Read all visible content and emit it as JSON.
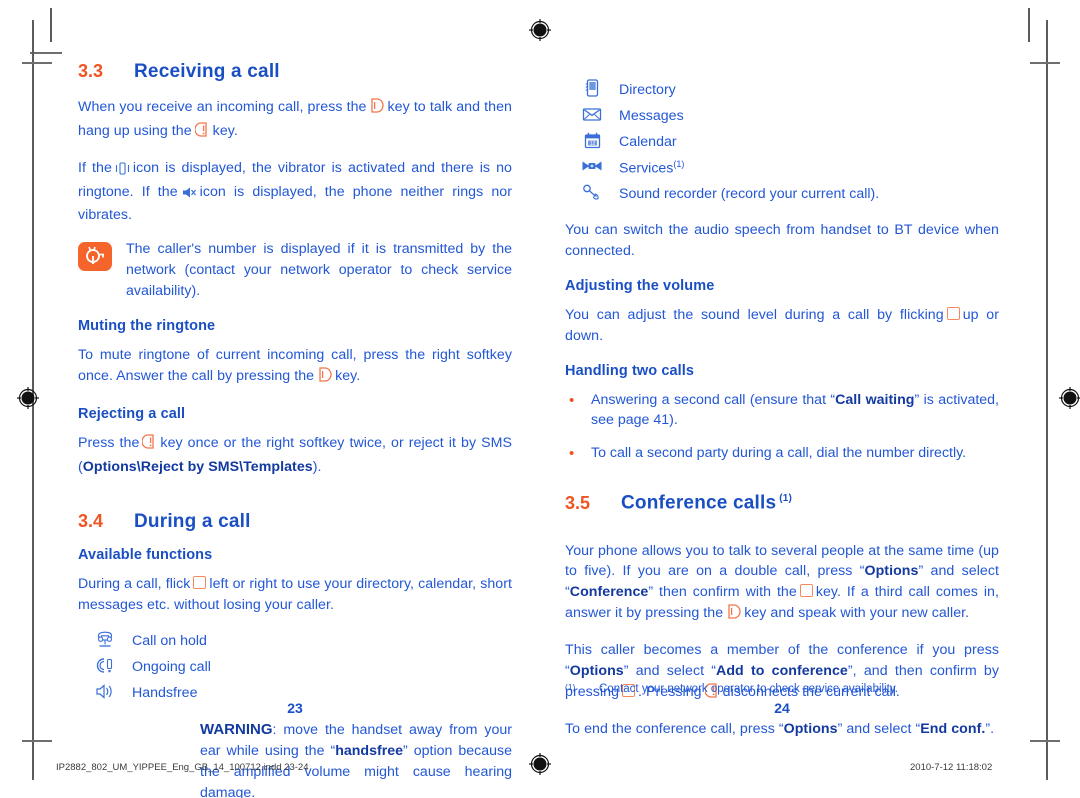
{
  "document": {
    "left_page_number": "23",
    "right_page_number": "24",
    "slug_file": "IP2882_802_UM_YIPPEE_Eng_GB_14_100712.indd  23-24",
    "slug_date": "2010-7-12  11:18:02"
  },
  "colors": {
    "heading_number": "#ef5423",
    "heading_title": "#1a4fc4",
    "body_text": "#2257d6",
    "tip_icon_bg": "#f4642b",
    "bullet": "#ef5423"
  },
  "left_column": {
    "section_33": {
      "number": "3.3",
      "title": "Receiving a call"
    },
    "para_1_a": "When you receive an incoming call, press the",
    "para_1_b": "key to talk and then hang up using the",
    "para_1_c": "key.",
    "para_2_a": "If the",
    "para_2_b": "icon is displayed, the vibrator is activated and there is no ringtone. If the",
    "para_2_c": "icon is displayed, the phone neither rings nor vibrates.",
    "tip": "The caller's number is displayed if it is transmitted by the network (contact your network operator to check service availability).",
    "sub_muting": "Muting the ringtone",
    "para_muting_a": "To mute ringtone of current incoming call, press the right softkey once. Answer the call by pressing the",
    "para_muting_b": "key.",
    "sub_rejecting": "Rejecting a call",
    "para_rejecting_a": "Press the",
    "para_rejecting_b": "key once or the right softkey twice, or reject it by SMS (",
    "para_rejecting_bold": "Options\\Reject by SMS\\Templates",
    "para_rejecting_c": ").",
    "section_34": {
      "number": "3.4",
      "title": "During a call"
    },
    "sub_available": "Available functions",
    "para_during_a": "During a call, flick",
    "para_during_b": "left or right to use your directory, calendar, short messages etc. without losing your caller.",
    "function_items": [
      {
        "icon": "call-on-hold-icon",
        "glyph": "☎",
        "label": "Call on hold"
      },
      {
        "icon": "ongoing-call-icon",
        "glyph": "✆",
        "label": "Ongoing call"
      },
      {
        "icon": "handsfree-speaker-icon",
        "glyph": "ὐA",
        "label": "Handsfree"
      }
    ],
    "warning_label": "WARNING",
    "warning_a": ": move the handset away from your ear while using the “",
    "warning_bold": "handsfree",
    "warning_b": "” option because the amplified volume might cause hearing damage."
  },
  "right_column": {
    "app_items": [
      {
        "icon": "directory-icon",
        "label": "Directory",
        "sup": ""
      },
      {
        "icon": "messages-envelope-icon",
        "label": "Messages",
        "sup": ""
      },
      {
        "icon": "calendar-icon",
        "label": "Calendar",
        "sup": ""
      },
      {
        "icon": "services-icon",
        "label": "Services",
        "sup": "(1)"
      },
      {
        "icon": "sound-recorder-icon",
        "label": "Sound recorder (record your current call).",
        "sup": ""
      }
    ],
    "para_bt": "You can switch the audio speech from handset to BT device when connected.",
    "sub_volume": "Adjusting the volume",
    "para_volume_a": "You can adjust the sound level during a call by flicking",
    "para_volume_b": "up or down.",
    "sub_two_calls": "Handling two calls",
    "bullets": [
      {
        "pre": "Answering a second call (ensure that “",
        "bold": "Call waiting",
        "post": "” is activated, see page 41)."
      },
      {
        "pre": "To call a second party during a call, dial the number directly.",
        "bold": "",
        "post": ""
      }
    ],
    "section_35": {
      "number": "3.5",
      "title": "Conference calls",
      "sup": "(1)"
    },
    "para_conf_1a": "Your phone allows you to talk to several people at the same time (up to five). If you are on a double call, press “",
    "para_conf_1_bold1": "Options",
    "para_conf_1b": "” and select “",
    "para_conf_1_bold2": "Conference",
    "para_conf_1c": "” then confirm with the",
    "para_conf_1d": "key. If a third call comes in, answer it by pressing the",
    "para_conf_1e": "key and speak with your new caller.",
    "para_conf_2a": "This caller becomes a member of the conference if you press “",
    "para_conf_2_bold1": "Options",
    "para_conf_2b": "” and select “",
    "para_conf_2_bold2": "Add to conference",
    "para_conf_2c": "”, and then confirm by pressing",
    "para_conf_2d": ". Pressing",
    "para_conf_2e": "disconnects the current call.",
    "para_conf_3a": "To end the conference call, press “",
    "para_conf_3_bold1": "Options",
    "para_conf_3b": "” and select “",
    "para_conf_3_bold2": "End conf.",
    "para_conf_3c": "”.",
    "footnote_mark": "(1)",
    "footnote_text": "Contact your network operator to check service availability."
  }
}
